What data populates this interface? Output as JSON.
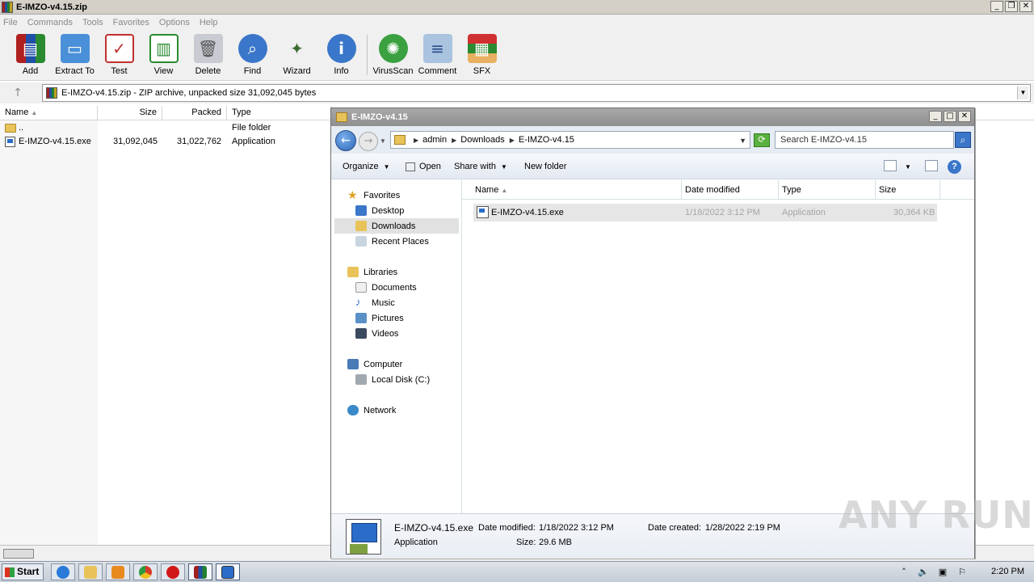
{
  "winrar": {
    "title": "E-IMZO-v4.15.zip",
    "menu": [
      "File",
      "Commands",
      "Tools",
      "Favorites",
      "Options",
      "Help"
    ],
    "toolbar": [
      {
        "label": "Add",
        "icon": "add-archive-icon"
      },
      {
        "label": "Extract To",
        "icon": "extract-icon"
      },
      {
        "label": "Test",
        "icon": "test-icon"
      },
      {
        "label": "View",
        "icon": "view-icon"
      },
      {
        "label": "Delete",
        "icon": "delete-icon"
      },
      {
        "label": "Find",
        "icon": "find-icon"
      },
      {
        "label": "Wizard",
        "icon": "wizard-icon"
      },
      {
        "label": "Info",
        "icon": "info-icon"
      },
      {
        "label": "VirusScan",
        "icon": "virusscan-icon"
      },
      {
        "label": "Comment",
        "icon": "comment-icon"
      },
      {
        "label": "SFX",
        "icon": "sfx-icon"
      }
    ],
    "address": "E-IMZO-v4.15.zip - ZIP archive, unpacked size 31,092,045 bytes",
    "columns": [
      "Name",
      "Size",
      "Packed",
      "Type"
    ],
    "rows": [
      {
        "name": "..",
        "size": "",
        "packed": "",
        "type": "File folder"
      },
      {
        "name": "E-IMZO-v4.15.exe",
        "size": "31,092,045",
        "packed": "31,022,762",
        "type": "Application"
      }
    ]
  },
  "explorer": {
    "title": "E-IMZO-v4.15",
    "breadcrumb": [
      "admin",
      "Downloads",
      "E-IMZO-v4.15"
    ],
    "search_placeholder": "Search E-IMZO-v4.15",
    "commands": {
      "organize": "Organize",
      "open": "Open",
      "share": "Share with",
      "new_folder": "New folder"
    },
    "nav": {
      "favorites": "Favorites",
      "desktop": "Desktop",
      "downloads": "Downloads",
      "recent": "Recent Places",
      "libraries": "Libraries",
      "documents": "Documents",
      "music": "Music",
      "pictures": "Pictures",
      "videos": "Videos",
      "computer": "Computer",
      "local_disk": "Local Disk (C:)",
      "network": "Network"
    },
    "columns": [
      "Name",
      "Date modified",
      "Type",
      "Size"
    ],
    "file": {
      "name": "E-IMZO-v4.15.exe",
      "date": "1/18/2022 3:12 PM",
      "type": "Application",
      "size": "30,364 KB"
    },
    "details": {
      "name": "E-IMZO-v4.15.exe",
      "type": "Application",
      "modified_label": "Date modified:",
      "modified": "1/18/2022 3:12 PM",
      "size_label": "Size:",
      "size": "29.6 MB",
      "created_label": "Date created:",
      "created": "1/28/2022 2:19 PM"
    }
  },
  "taskbar": {
    "start": "Start",
    "clock": "2:20 PM"
  },
  "watermark": "ANY RUN"
}
